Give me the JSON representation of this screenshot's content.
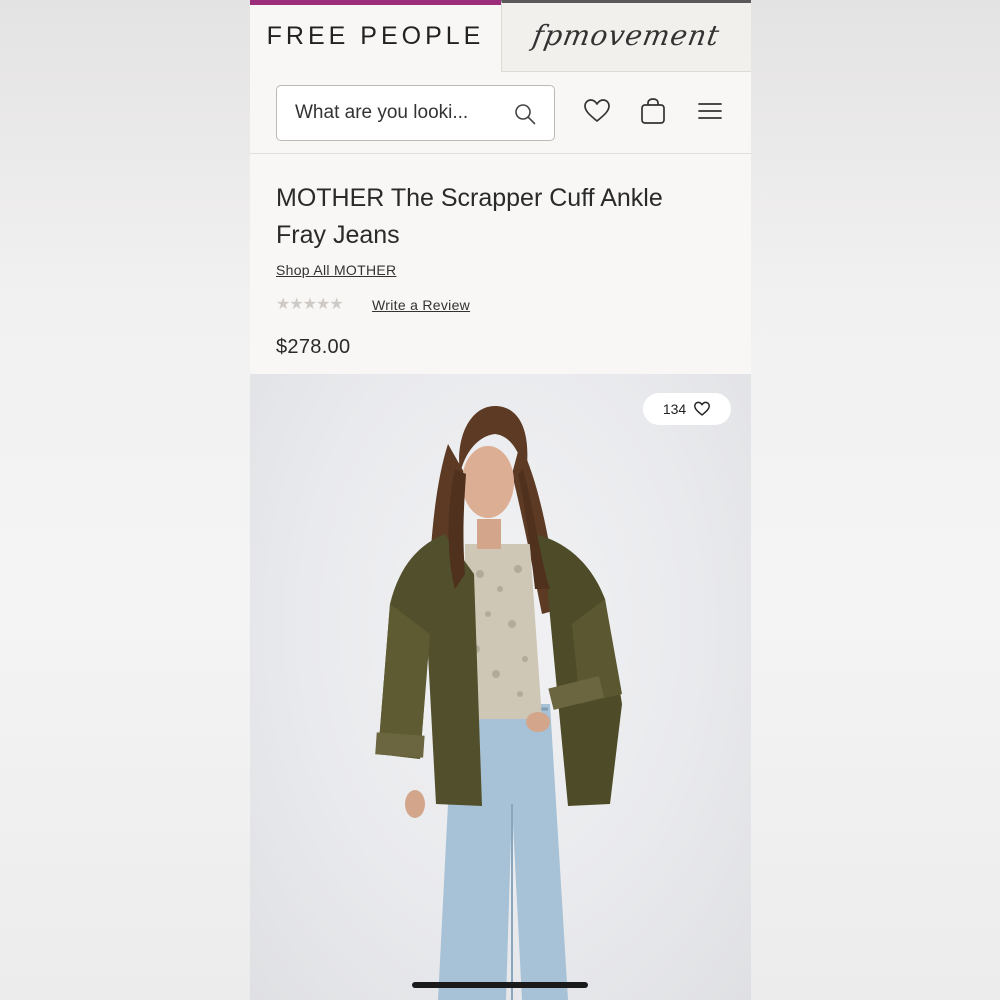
{
  "header": {
    "brand_primary": "FREE PEOPLE",
    "brand_secondary": "fpmovement",
    "accent_color": "#9b2d7a"
  },
  "search": {
    "placeholder": "What are you looki..."
  },
  "header_icons": [
    "heart-icon",
    "bag-icon",
    "menu-icon"
  ],
  "product": {
    "title": "MOTHER The Scrapper Cuff Ankle Fray Jeans",
    "shop_all_link": "Shop All MOTHER",
    "rating_stars": "★★★★★",
    "rating": 0,
    "write_review_link": "Write a Review",
    "price": "$278.00"
  },
  "image": {
    "favorites_count": "134",
    "description_icon": "heart-icon"
  }
}
